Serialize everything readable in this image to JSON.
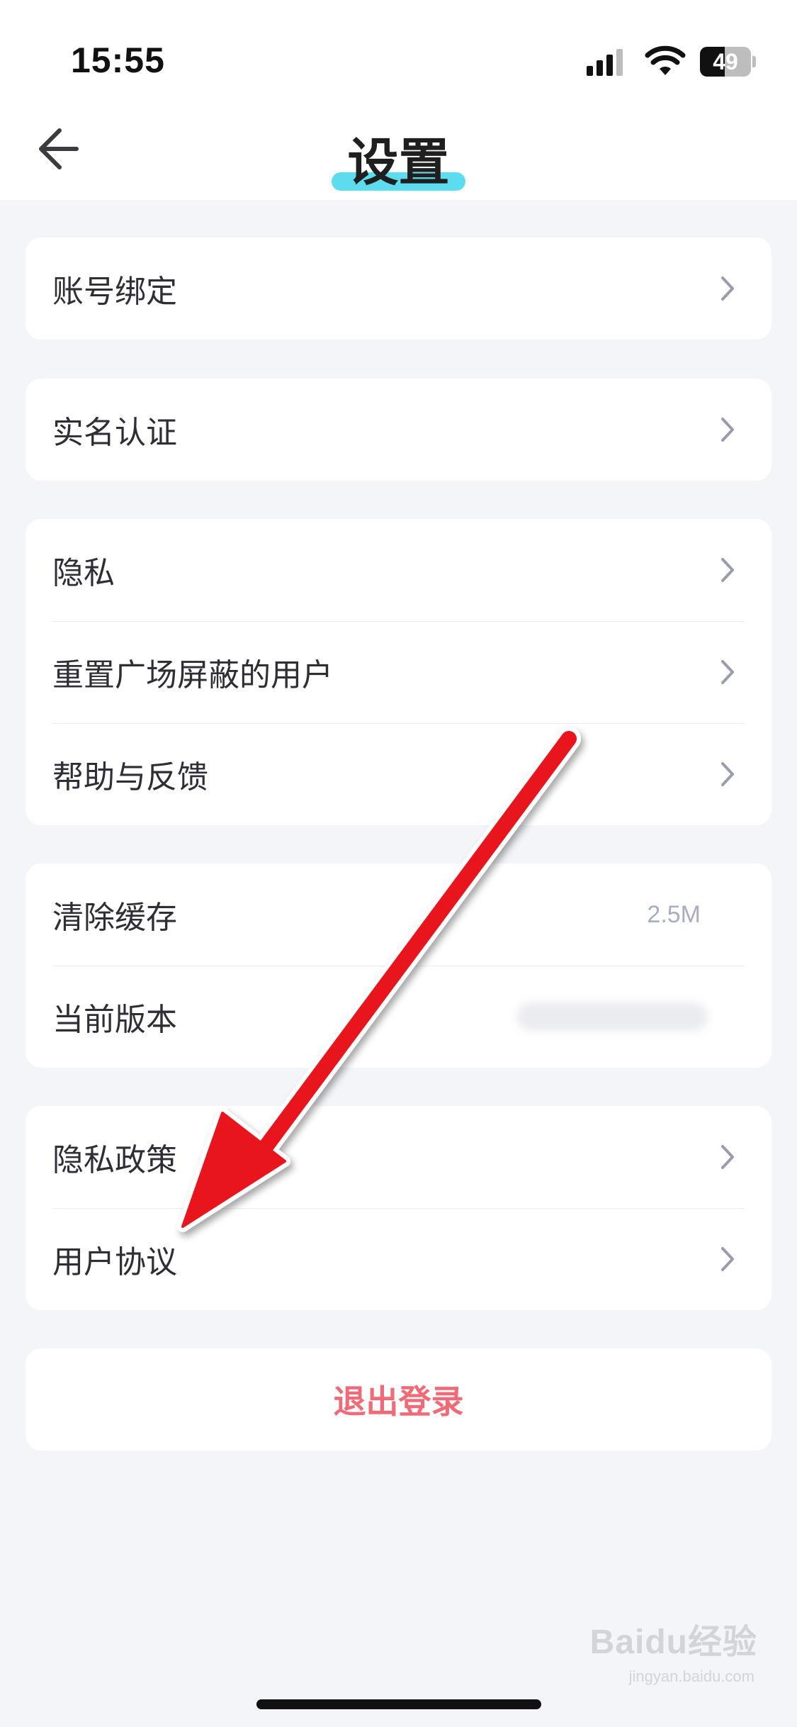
{
  "status_bar": {
    "time": "15:55",
    "battery": "49"
  },
  "header": {
    "title": "设置",
    "back_icon": "back-arrow-icon"
  },
  "groups": [
    {
      "items": [
        {
          "label": "账号绑定"
        }
      ]
    },
    {
      "items": [
        {
          "label": "实名认证"
        }
      ]
    },
    {
      "items": [
        {
          "label": "隐私"
        },
        {
          "label": "重置广场屏蔽的用户"
        },
        {
          "label": "帮助与反馈"
        }
      ]
    },
    {
      "items": [
        {
          "label": "清除缓存",
          "value": "2.5M"
        },
        {
          "label": "当前版本"
        }
      ]
    },
    {
      "items": [
        {
          "label": "隐私政策"
        },
        {
          "label": "用户协议"
        }
      ]
    }
  ],
  "logout": {
    "label": "退出登录"
  },
  "watermark": {
    "text": "Baidu经验",
    "sub": "jingyan.baidu.com"
  },
  "colors": {
    "accent": "#5ddcf0",
    "logout": "#f06a78",
    "annotation_arrow": "#e8151d"
  }
}
